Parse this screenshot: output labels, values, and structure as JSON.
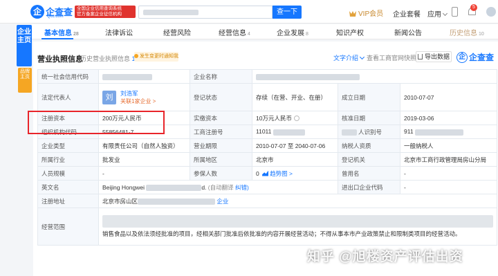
{
  "header": {
    "logo_mark": "企",
    "logo_name": "企查查",
    "logo_url": "Qcc.com",
    "badge_line1": "全国企业信用查询系统",
    "badge_line2": "官方备案企业征信机构",
    "search_button": "查一下",
    "vip_label": "VIP会员",
    "package_label": "企业套餐",
    "apps_label": "应用",
    "notification_count": "5"
  },
  "side": {
    "main_label": "企业主页",
    "brand_label": "品牌主页"
  },
  "tabs": [
    {
      "label": "基本信息",
      "count": "28"
    },
    {
      "label": "法律诉讼",
      "count": ""
    },
    {
      "label": "经营风险",
      "count": ""
    },
    {
      "label": "经营信息",
      "count": "4"
    },
    {
      "label": "企业发展",
      "count": "8"
    },
    {
      "label": "知识产权",
      "count": ""
    },
    {
      "label": "新闻公告",
      "count": ""
    },
    {
      "label": "历史信息",
      "count": "10"
    }
  ],
  "section": {
    "title": "营业执照信息",
    "history_label": "历史营业执照信息",
    "history_count": "1",
    "change_badge": "发生变更时通知我",
    "text_intro": "文字介绍",
    "official_site": "查看工商官网快照",
    "export": "导出数据",
    "brand_mark": "企",
    "brand_name": "企查查"
  },
  "table": {
    "credit_code_label": "统一社会信用代码",
    "company_name_label": "企业名称",
    "legal_rep_label": "法定代表人",
    "legal_rep_avatar": "刘",
    "legal_rep_name": "刘浩军",
    "legal_rep_related": "关联1家企业 >",
    "reg_status_label": "登记状态",
    "reg_status_value": "存续（在营、开业、在册）",
    "est_date_label": "成立日期",
    "est_date_value": "2010-07-07",
    "reg_capital_label": "注册资本",
    "reg_capital_value": "200万元人民币",
    "paid_capital_label": "实缴资本",
    "paid_capital_value": "10万元人民币",
    "approval_date_label": "核准日期",
    "approval_date_value": "2019-03-06",
    "org_code_label": "组织机构代码",
    "org_code_value": "55856481-7",
    "biz_reg_label": "工商注册号",
    "biz_reg_value": "11011",
    "taxpayer_id_label": "人识别号",
    "taxpayer_id_value": "911",
    "company_type_label": "企业类型",
    "company_type_value": "有限责任公司（自然人独资）",
    "term_label": "营业期限",
    "term_value": "2010-07-07 至 2040-07-06",
    "taxpayer_qual_label": "纳税人资质",
    "taxpayer_qual_value": "一般纳税人",
    "industry_label": "所属行业",
    "industry_value": "批发业",
    "region_label": "所属地区",
    "region_value": "北京市",
    "reg_authority_label": "登记机关",
    "reg_authority_value": "北京市工商行政管理局房山分局",
    "staff_size_label": "人员规模",
    "staff_size_value": "-",
    "insured_label": "参保人数",
    "insured_value": "0",
    "trend_label": "趋势图 >",
    "former_name_label": "曾用名",
    "former_name_value": "-",
    "english_name_label": "英文名",
    "english_name_value": "Beijing Hongwei",
    "english_name_suffix": "d.",
    "auto_translate": "(自动翻译",
    "correction": "纠错)",
    "import_export_label": "进出口企业代码",
    "import_export_value": "-",
    "address_label": "注册地址",
    "address_prefix": "北京市房山区",
    "address_link": "企业",
    "scope_label": "经营范围",
    "scope_value": "销售食品以及依法须经批准的项目，经相关部门批准后依批准的内容开展经营活动；不得从事本市产业政策禁止和限制类项目的经营活动。"
  },
  "watermark": "知乎 @旭楼资产评估出资"
}
